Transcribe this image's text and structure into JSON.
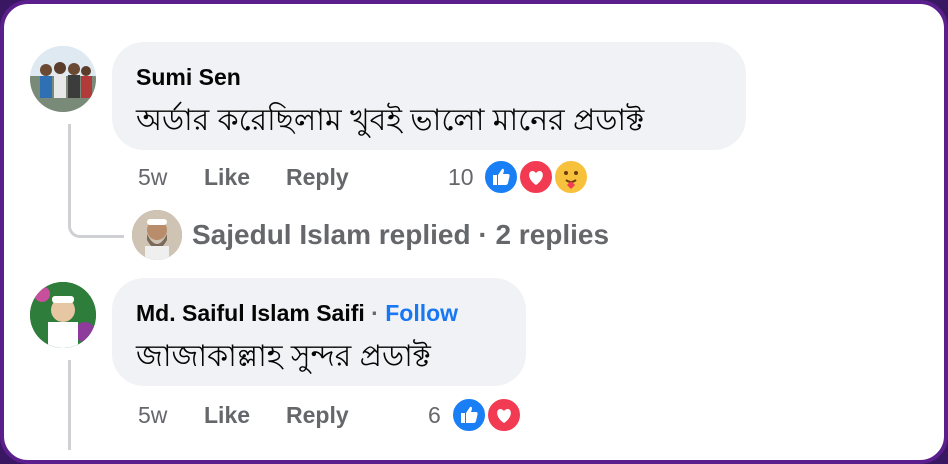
{
  "comments": [
    {
      "author": "Sumi Sen",
      "text": "অর্ডার করেছিলাম খুবই ভালো মানের প্রডাক্ট",
      "time": "5w",
      "like_label": "Like",
      "reply_label": "Reply",
      "reaction_count": "10",
      "reactions": [
        "like-icon",
        "love-icon",
        "care-icon"
      ]
    },
    {
      "author": "Md. Saiful Islam Saifi",
      "separator": "·",
      "follow_label": "Follow",
      "text": "জাজাকাল্লাহ সুন্দর প্রডাক্ট",
      "time": "5w",
      "like_label": "Like",
      "reply_label": "Reply",
      "reaction_count": "6",
      "reactions": [
        "like-icon",
        "love-icon"
      ]
    }
  ],
  "replies_summary": {
    "name": "Sajedul Islam",
    "action": "replied",
    "separator": "·",
    "count_text": "2 replies"
  },
  "colors": {
    "frame": "#5a1f8c",
    "bubble": "#f0f2f5",
    "like": "#1a7ef5",
    "love": "#f23a52",
    "care": "#f7c13c",
    "follow": "#1877f2"
  }
}
